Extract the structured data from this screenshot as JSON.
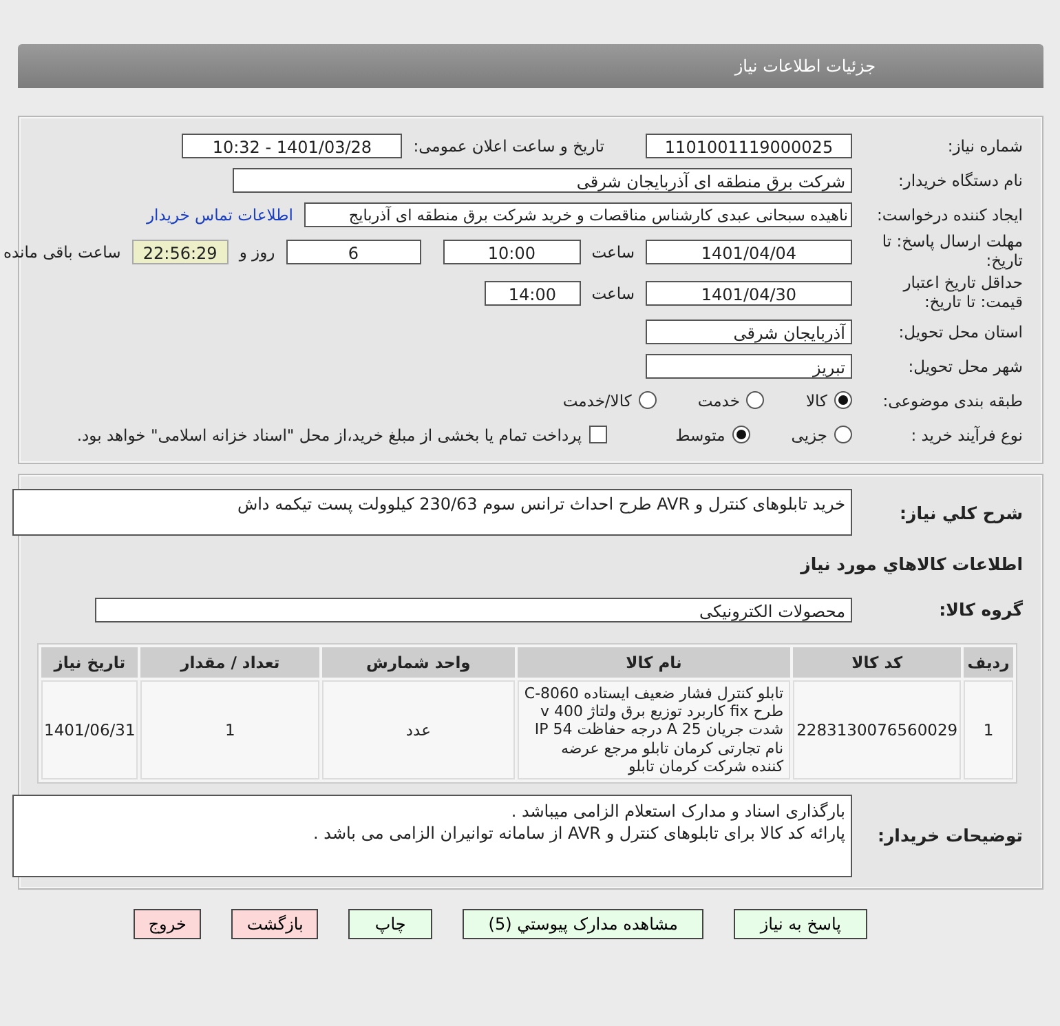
{
  "header": {
    "title": "جزئیات اطلاعات نیاز"
  },
  "need_number": {
    "label": "شماره نیاز:",
    "value": "1101001119000025"
  },
  "announce": {
    "label": "تاریخ و ساعت اعلان عمومی:",
    "value": "1401/03/28 - 10:32"
  },
  "buyer": {
    "label": "نام دستگاه خریدار:",
    "value": "شرکت برق منطقه ای آذربایجان شرقی"
  },
  "creator": {
    "label": "ایجاد کننده درخواست:",
    "value": "ناهیده  سبحانی عبدی کارشناس مناقصات و خرید شرکت برق منطقه ای آذربایج",
    "link": "اطلاعات تماس خریدار"
  },
  "deadline": {
    "label": "مهلت ارسال پاسخ: تا تاریخ:",
    "date": "1401/04/04",
    "time_label": "ساعت",
    "time": "10:00",
    "days": "6",
    "days_label": "روز و",
    "remaining": "22:56:29",
    "remaining_label": "ساعت باقی مانده"
  },
  "validity": {
    "label": "حداقل تاریخ اعتبار قیمت: تا تاریخ:",
    "date": "1401/04/30",
    "time_label": "ساعت",
    "time": "14:00"
  },
  "province": {
    "label": "استان محل تحویل:",
    "value": "آذربایجان شرقی"
  },
  "city": {
    "label": "شهر محل تحویل:",
    "value": "تبریز"
  },
  "category": {
    "label": "طبقه بندی موضوعی:",
    "options": [
      {
        "label": "کالا",
        "selected": true
      },
      {
        "label": "خدمت",
        "selected": false
      },
      {
        "label": "کالا/خدمت",
        "selected": false
      }
    ]
  },
  "process": {
    "label": "نوع فرآیند خرید :",
    "options": [
      {
        "label": "جزیی",
        "selected": false
      },
      {
        "label": "متوسط",
        "selected": true
      }
    ],
    "payment": {
      "checked": false,
      "text": "پرداخت تمام یا بخشی از مبلغ خرید،از محل \"اسناد خزانه اسلامی\" خواهد بود."
    }
  },
  "description": {
    "label": "شرح کلي نياز:",
    "value": "خرید تابلوهای کنترل و AVR طرح احداث ترانس سوم 230/63 کیلوولت پست تیکمه داش"
  },
  "goods_title": "اطلاعات کالاهاي مورد نياز",
  "goods_group": {
    "label": "گروه کالا:",
    "value": "محصولات الکترونیکی"
  },
  "table": {
    "columns": [
      "ردیف",
      "کد کالا",
      "نام کالا",
      "واحد شمارش",
      "تعداد / مقدار",
      "تاریخ نیاز"
    ],
    "rows": [
      [
        "1",
        "2283130076560029",
        "تابلو کنترل فشار ضعیف ایستاده C-8060 طرح fix کاربرد توزیع برق ولتاژ 400 v شدت جریان 25 A درجه حفاظت IP 54 نام تجارتی کرمان تابلو مرجع عرضه کننده شرکت کرمان تابلو",
        "عدد",
        "1",
        "1401/06/31"
      ]
    ]
  },
  "buyer_notes": {
    "label": "توضیحات خریدار:",
    "lines": [
      "بارگذاری اسناد و مدارک استعلام الزامی میباشد .",
      "پارائه کد کالا برای تابلوهای کنترل و AVR از سامانه توانیران الزامی می باشد ."
    ]
  },
  "buttons": [
    {
      "label": "پاسخ به نیاز",
      "kind": "normal"
    },
    {
      "label": "مشاهده مدارک پیوستي (5)",
      "kind": "normal"
    },
    {
      "label": "چاپ",
      "kind": "normal"
    },
    {
      "label": "بازگشت",
      "kind": "danger"
    },
    {
      "label": "خروج",
      "kind": "danger"
    }
  ]
}
